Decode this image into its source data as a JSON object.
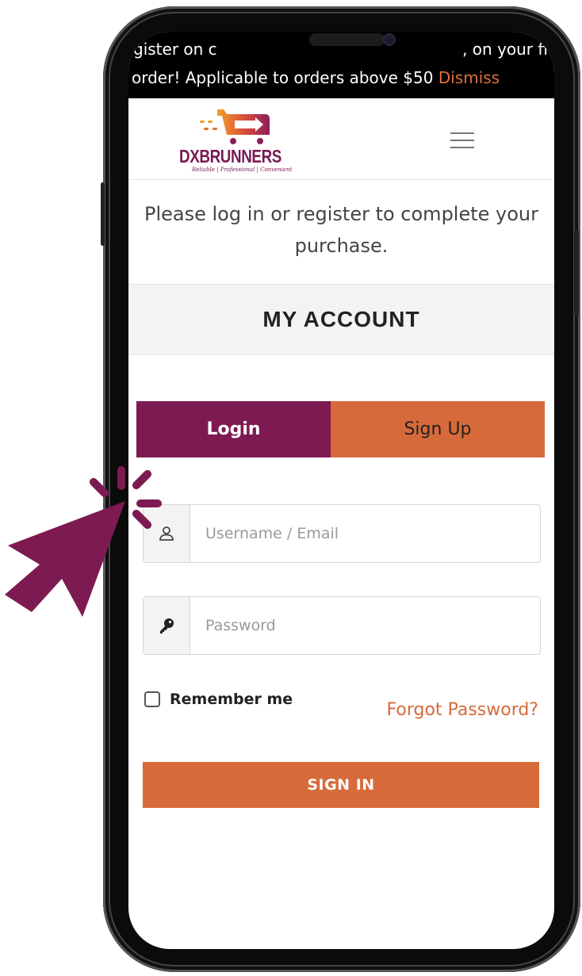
{
  "notice": {
    "line1_left": "gister on c",
    "line1_right": ", on your fi",
    "line2_text": "order! Applicable to orders above $50 ",
    "dismiss_label": "Dismiss"
  },
  "header": {
    "logo_name": "DXBRUNNERS",
    "logo_tagline": "Reliable | Professional | Convenient",
    "menu_icon": "hamburger-menu-icon"
  },
  "prompt": {
    "line1": "Please log in or register to complete your",
    "line2": "purchase."
  },
  "account": {
    "title": "MY ACCOUNT"
  },
  "tabs": [
    {
      "label": "Login",
      "active": true
    },
    {
      "label": "Sign Up",
      "active": false
    }
  ],
  "form": {
    "username_placeholder": "Username / Email",
    "username_icon": "user-icon",
    "password_placeholder": "Password",
    "password_icon": "key-icon",
    "remember_label": "Remember me",
    "remember_checked": false,
    "forgot_label": "Forgot Password?",
    "signin_label": "SIGN IN"
  },
  "colors": {
    "brand_purple": "#7e1a52",
    "brand_orange": "#d76a3a"
  },
  "overlay": {
    "pointer_icon": "click-pointer-icon"
  }
}
